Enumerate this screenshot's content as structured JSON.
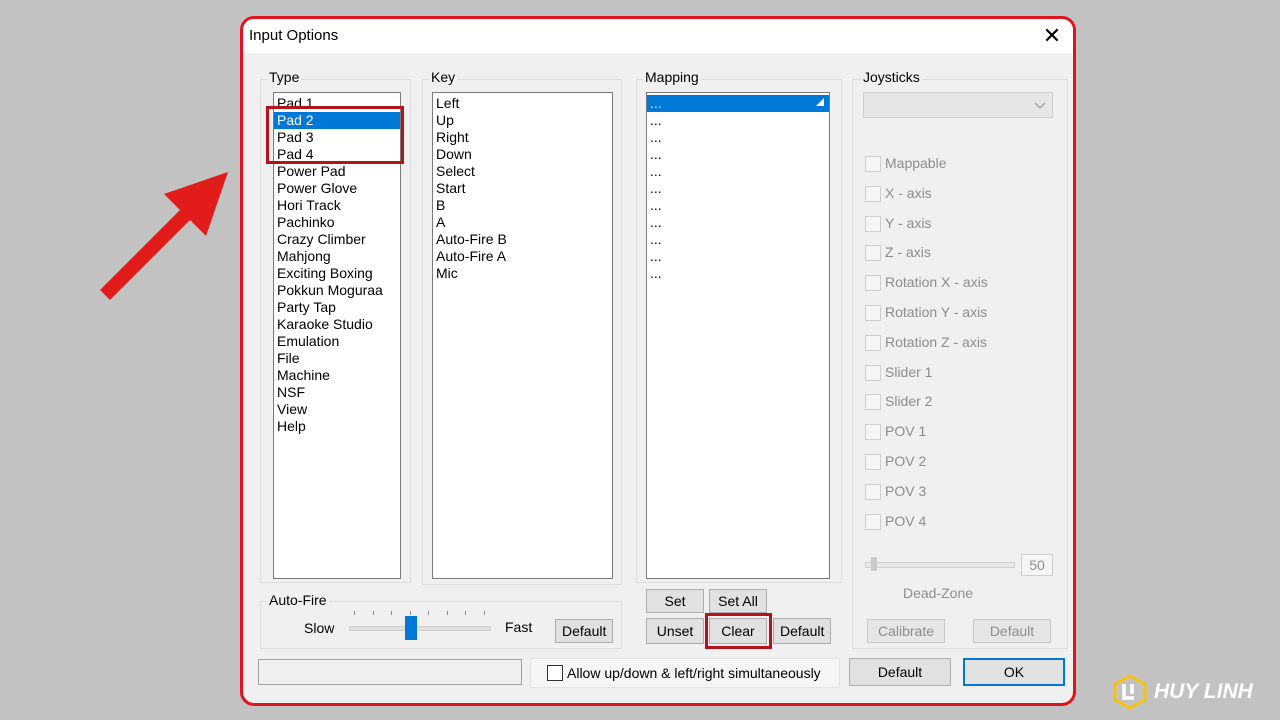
{
  "window": {
    "title": "Input Options",
    "close_label": "✕"
  },
  "type": {
    "label": "Type",
    "items": [
      "Pad 1",
      "Pad 2",
      "Pad 3",
      "Pad 4",
      "Power Pad",
      "Power Glove",
      "Hori Track",
      "Pachinko",
      "Crazy Climber",
      "Mahjong",
      "Exciting Boxing",
      "Pokkun Moguraa",
      "Party Tap",
      "Karaoke Studio",
      "Emulation",
      "File",
      "Machine",
      "NSF",
      "View",
      "Help"
    ],
    "selected_index": 1
  },
  "key": {
    "label": "Key",
    "items": [
      "Left",
      "Up",
      "Right",
      "Down",
      "Select",
      "Start",
      "B",
      "A",
      "Auto-Fire B",
      "Auto-Fire A",
      "Mic"
    ]
  },
  "mapping": {
    "label": "Mapping",
    "items": [
      "...",
      "...",
      "...",
      "...",
      "...",
      "...",
      "...",
      "...",
      "...",
      "...",
      "..."
    ],
    "selected_index": 0,
    "set_label": "Set",
    "set_all_label": "Set All",
    "unset_label": "Unset",
    "clear_label": "Clear",
    "default_label": "Default"
  },
  "joysticks": {
    "label": "Joysticks",
    "options": [
      "Mappable",
      "X - axis",
      "Y - axis",
      "Z - axis",
      "Rotation X - axis",
      "Rotation Y - axis",
      "Rotation Z - axis",
      "Slider 1",
      "Slider 2",
      "POV 1",
      "POV 2",
      "POV 3",
      "POV 4"
    ],
    "deadzone_value": "50",
    "deadzone_label": "Dead-Zone",
    "calibrate_label": "Calibrate",
    "default_label": "Default"
  },
  "autofire": {
    "label": "Auto-Fire",
    "slow_label": "Slow",
    "fast_label": "Fast",
    "default_label": "Default",
    "level": 0.44
  },
  "footer": {
    "simultaneous_label": "Allow up/down & left/right simultaneously",
    "default_label": "Default",
    "ok_label": "OK"
  },
  "watermark": {
    "text": "HUY LINH"
  },
  "colors": {
    "accent": "#0078d7",
    "highlight": "#e0141c",
    "arrow": "#e21b1b"
  }
}
